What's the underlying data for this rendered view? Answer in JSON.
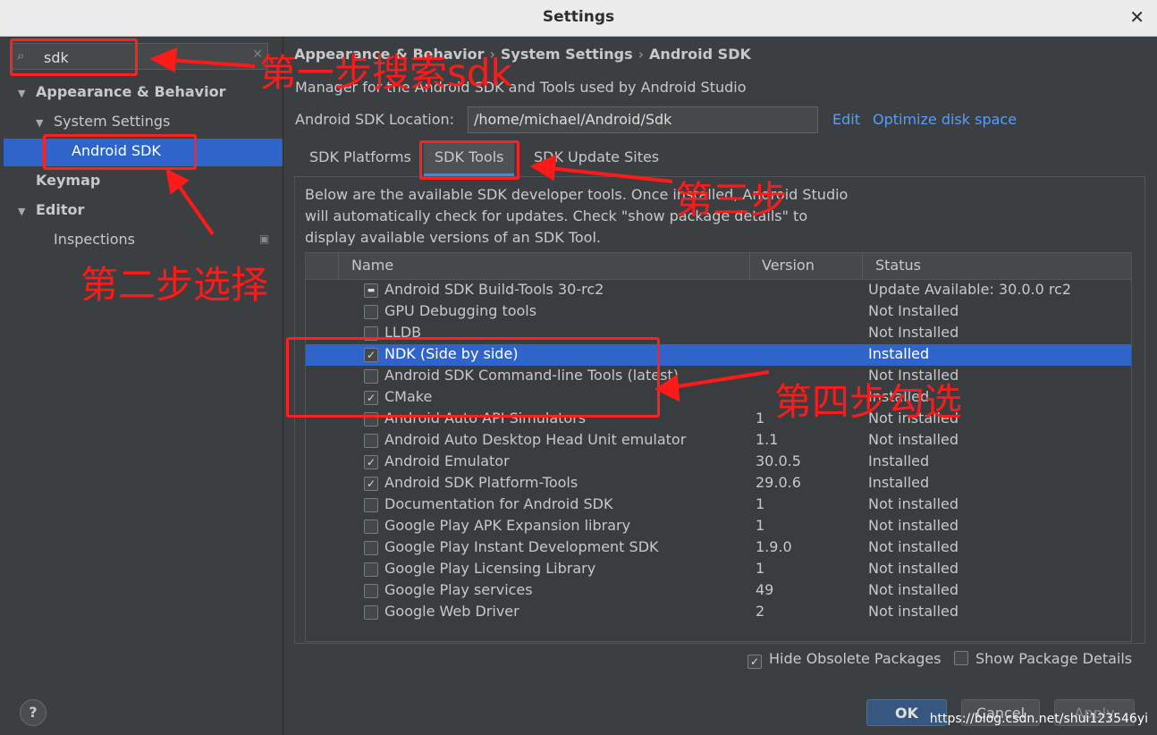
{
  "window": {
    "title": "Settings"
  },
  "search": {
    "value": "sdk"
  },
  "sidebar": {
    "items": [
      {
        "label": "Appearance & Behavior"
      },
      {
        "label": "System Settings"
      },
      {
        "label": "Android SDK"
      },
      {
        "label": "Keymap"
      },
      {
        "label": "Editor"
      },
      {
        "label": "Inspections"
      }
    ]
  },
  "breadcrumb": {
    "a": "Appearance & Behavior",
    "b": "System Settings",
    "c": "Android SDK"
  },
  "main": {
    "description": "Manager for the Android SDK and Tools used by Android Studio",
    "location_label": "Android SDK Location:",
    "location_value": "/home/michael/Android/Sdk",
    "edit_link": "Edit",
    "optimize_link": "Optimize disk space"
  },
  "tabs": [
    {
      "label": "SDK Platforms"
    },
    {
      "label": "SDK Tools"
    },
    {
      "label": "SDK Update Sites"
    }
  ],
  "info_text": "Below are the available SDK developer tools. Once installed, Android Studio will automatically check for updates. Check \"show package details\" to display available versions of an SDK Tool.",
  "table": {
    "columns": [
      "Name",
      "Version",
      "Status"
    ],
    "rows": [
      {
        "name": "Android SDK Build-Tools 30-rc2",
        "version": "",
        "status": "Update Available: 30.0.0 rc2",
        "check": "partial"
      },
      {
        "name": "GPU Debugging tools",
        "version": "",
        "status": "Not Installed",
        "check": "none"
      },
      {
        "name": "LLDB",
        "version": "",
        "status": "Not Installed",
        "check": "none"
      },
      {
        "name": "NDK (Side by side)",
        "version": "",
        "status": "Installed",
        "check": "checked",
        "selected": true
      },
      {
        "name": "Android SDK Command-line Tools (latest)",
        "version": "",
        "status": "Not Installed",
        "check": "none"
      },
      {
        "name": "CMake",
        "version": "",
        "status": "Installed",
        "check": "checked"
      },
      {
        "name": "Android Auto API Simulators",
        "version": "1",
        "status": "Not installed",
        "check": "none"
      },
      {
        "name": "Android Auto Desktop Head Unit emulator",
        "version": "1.1",
        "status": "Not installed",
        "check": "none"
      },
      {
        "name": "Android Emulator",
        "version": "30.0.5",
        "status": "Installed",
        "check": "checked"
      },
      {
        "name": "Android SDK Platform-Tools",
        "version": "29.0.6",
        "status": "Installed",
        "check": "checked"
      },
      {
        "name": "Documentation for Android SDK",
        "version": "1",
        "status": "Not installed",
        "check": "none"
      },
      {
        "name": "Google Play APK Expansion library",
        "version": "1",
        "status": "Not installed",
        "check": "none"
      },
      {
        "name": "Google Play Instant Development SDK",
        "version": "1.9.0",
        "status": "Not installed",
        "check": "none"
      },
      {
        "name": "Google Play Licensing Library",
        "version": "1",
        "status": "Not installed",
        "check": "none"
      },
      {
        "name": "Google Play services",
        "version": "49",
        "status": "Not installed",
        "check": "none"
      },
      {
        "name": "Google Web Driver",
        "version": "2",
        "status": "Not installed",
        "check": "none"
      }
    ]
  },
  "options": {
    "hide_obsolete": "Hide Obsolete Packages",
    "show_details": "Show Package Details"
  },
  "buttons": {
    "ok": "OK",
    "cancel": "Cancel",
    "apply": "Apply",
    "help": "?"
  },
  "annotations": {
    "step1": "第一步搜索sdk",
    "step2": "第二步选择",
    "step3": "第三步",
    "step4": "第四步勾选",
    "color": "#ff1a1a"
  },
  "watermark": "https://blog.csdn.net/shui123546yi"
}
